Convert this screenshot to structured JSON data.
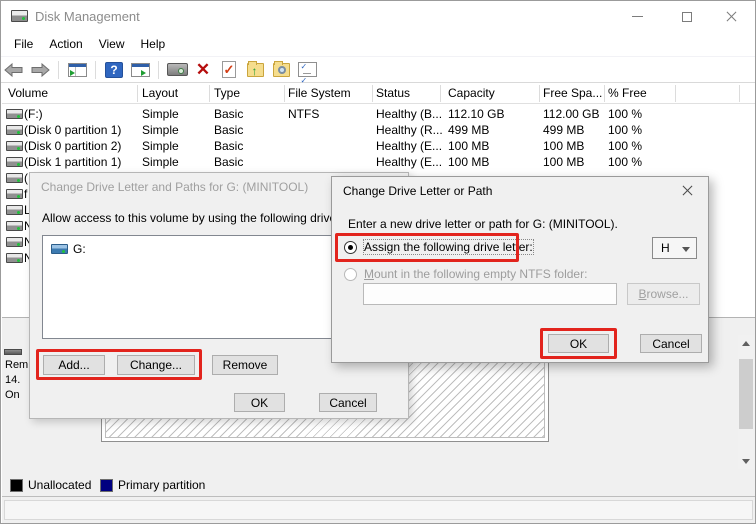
{
  "window": {
    "title": "Disk Management"
  },
  "menu": {
    "items": [
      "File",
      "Action",
      "View",
      "Help"
    ]
  },
  "toolbar": {
    "icon_names": [
      "back-icon",
      "forward-icon",
      "show-console-tree-icon",
      "help-icon",
      "show-action-pane-icon",
      "monitor-icon",
      "delete-icon",
      "check-document-icon",
      "folder-up-icon",
      "folder-search-icon",
      "tasklist-icon"
    ],
    "glyphs": {
      "help": "?",
      "delete": "✕",
      "check": "✓",
      "up_arrow": "↑",
      "task_check": "✓✓"
    }
  },
  "volume_table": {
    "columns": [
      "Volume",
      "Layout",
      "Type",
      "File System",
      "Status",
      "Capacity",
      "Free Spa...",
      "% Free"
    ],
    "rows": [
      {
        "cells": [
          "(F:)",
          "Simple",
          "Basic",
          "NTFS",
          "Healthy (B...",
          "112.10 GB",
          "112.00 GB",
          "100 %"
        ]
      },
      {
        "cells": [
          "(Disk 0 partition 1)",
          "Simple",
          "Basic",
          "",
          "Healthy (R...",
          "499 MB",
          "499 MB",
          "100 %"
        ]
      },
      {
        "cells": [
          "(Disk 0 partition 2)",
          "Simple",
          "Basic",
          "",
          "Healthy (E...",
          "100 MB",
          "100 MB",
          "100 %"
        ]
      },
      {
        "cells": [
          "(Disk 1 partition 1)",
          "Simple",
          "Basic",
          "",
          "Healthy (E...",
          "100 MB",
          "100 MB",
          "100 %"
        ]
      }
    ],
    "partial_rows": [
      "(",
      "f",
      "L",
      "N",
      "N",
      "N"
    ]
  },
  "disk_panel": {
    "label_lines": [
      "Rem",
      "14.",
      "On"
    ]
  },
  "legend": {
    "items": [
      {
        "label": "Unallocated",
        "color": "#000000"
      },
      {
        "label": "Primary partition",
        "color": "#000080"
      }
    ]
  },
  "dialog1": {
    "title": "Change Drive Letter and Paths for G: (MINITOOL)",
    "instruction": "Allow access to this volume by using the following drive letter",
    "list_items": [
      {
        "label": "G:"
      }
    ],
    "buttons": {
      "add": "Add...",
      "change": "Change...",
      "remove": "Remove",
      "ok": "OK",
      "cancel": "Cancel"
    }
  },
  "dialog2": {
    "title": "Change Drive Letter or Path",
    "instruction": "Enter a new drive letter or path for G: (MINITOOL).",
    "assign_radio": {
      "label": "Assign the following drive letter:",
      "checked": true
    },
    "drive_letter_select": {
      "value": "H"
    },
    "mount_radio": {
      "access_key": "M",
      "label_rest": "ount in the following empty NTFS folder:",
      "checked": false
    },
    "folder_field": {
      "value": ""
    },
    "buttons": {
      "browse_access_key": "B",
      "browse_rest": "rowse...",
      "ok": "OK",
      "cancel": "Cancel"
    }
  },
  "colors": {
    "annotation_red": "#e2241d",
    "unallocated": "#000000",
    "primary_partition": "#000080"
  }
}
